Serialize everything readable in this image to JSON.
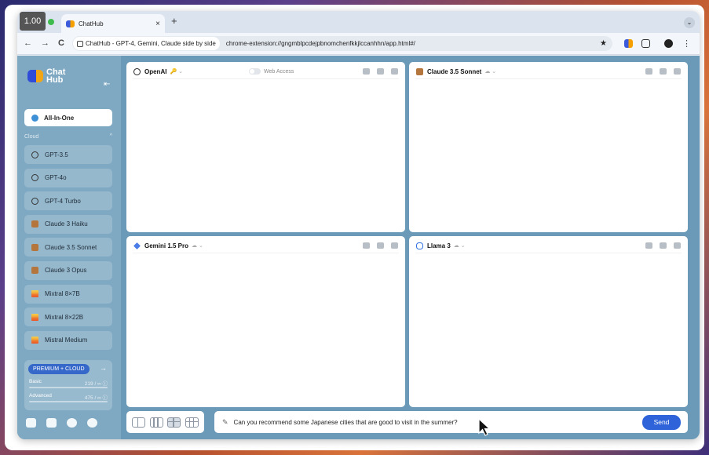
{
  "overlay": {
    "fps": "1.00"
  },
  "browser": {
    "tab_title": "ChatHub",
    "tab_close": "×",
    "new_tab": "+",
    "tab_menu": "⌄",
    "nav": {
      "back": "←",
      "forward": "→",
      "reload": "C"
    },
    "site_chip": "ChatHub - GPT-4, Gemini, Claude side by side",
    "url": "chrome-extension://gngmblpcdejpbnomchenfkkjlccanhhn/app.html#/",
    "bookmark_star": "★"
  },
  "sidebar": {
    "logo_line1": "Chat",
    "logo_line2": "Hub",
    "collapse_icon": "⇤",
    "all_in_one": "All-In-One",
    "cloud_header": "Cloud",
    "cloud_chevron": "^",
    "models": [
      {
        "label": "GPT-3.5",
        "icon": "openai-icon"
      },
      {
        "label": "GPT-4o",
        "icon": "openai-icon"
      },
      {
        "label": "GPT-4 Turbo",
        "icon": "openai-icon"
      },
      {
        "label": "Claude 3 Haiku",
        "icon": "anthropic-icon"
      },
      {
        "label": "Claude 3.5 Sonnet",
        "icon": "anthropic-icon"
      },
      {
        "label": "Claude 3 Opus",
        "icon": "anthropic-icon"
      },
      {
        "label": "Mixtral 8×7B",
        "icon": "mistral-icon"
      },
      {
        "label": "Mixtral 8×22B",
        "icon": "mistral-icon"
      },
      {
        "label": "Mistral Medium",
        "icon": "mistral-icon"
      }
    ],
    "premium": {
      "badge": "PREMIUM + CLOUD",
      "arrow": "→",
      "basic_label": "Basic",
      "basic_value": "219 / ∞ ⓘ",
      "advanced_label": "Advanced",
      "advanced_value": "475 / ∞ ⓘ"
    }
  },
  "panels": [
    {
      "bot": "OpenAI",
      "sub": "🔑 ⌄",
      "web_access": "Web Access",
      "icon": "openai-icon"
    },
    {
      "bot": "Claude 3.5 Sonnet",
      "sub": "☁ ⌄",
      "icon": "anthropic-icon"
    },
    {
      "bot": "Gemini 1.5 Pro",
      "sub": "☁ ⌄",
      "icon": "gemini-icon"
    },
    {
      "bot": "Llama 3",
      "sub": "☁ ⌄",
      "icon": "meta-icon"
    }
  ],
  "composer": {
    "value": "Can you recommend some Japanese cities that are good to visit in the summer?",
    "send_label": "Send"
  },
  "colors": {
    "accent": "#2f63d9",
    "app_bg": "#6a9ab7",
    "sidebar_bg": "#7fa9c2"
  }
}
